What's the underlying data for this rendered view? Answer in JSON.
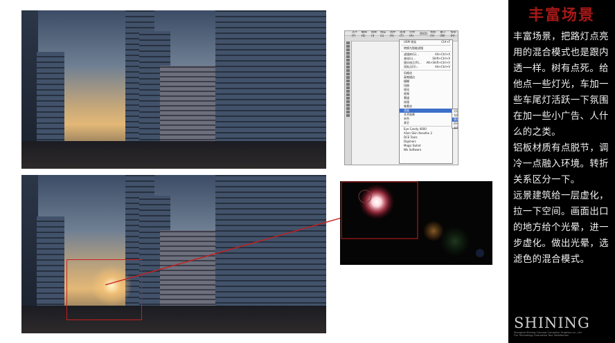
{
  "panel": {
    "title": "丰富场景",
    "paragraphs": [
      "丰富场景，把路灯点亮用的混合模式也是跟内透一样。树有点死。给他点一些灯光，车加一些车尾灯活跃一下氛围在加一些小广告、人什么的之类。",
      "铝板材质有点脱节，调冷一点融入环境。转折关系区分一下。",
      "远景建筑给一层虚化，拉一下空间。画面出口的地方给个光晕，进一步虚化。做出光晕，选滤色的混合模式。"
    ],
    "logo_word": "SHINING",
    "logo_sub1": "Shanghai Shining Concept Computer Graphics co., Ltd",
    "logo_sub2": "Our Technology Guarantee Your Satisfaction"
  },
  "photoshop": {
    "menubar": [
      "文件(F)",
      "编辑(E)",
      "图像(I)",
      "图层(L)",
      "选择(S)",
      "滤镜(T)",
      "分析(A)",
      "3D(D)",
      "视图(V)",
      "窗口(W)",
      "帮助(H)"
    ],
    "menu_items": [
      {
        "label": "USM 锐化",
        "shortcut": "Ctrl+F"
      },
      {
        "label": "转换为智能滤镜",
        "shortcut": ""
      },
      {
        "label": "滤镜库(G)...",
        "shortcut": "Alt+Ctrl+X"
      },
      {
        "label": "液化(L)...",
        "shortcut": "Shift+Ctrl+X"
      },
      {
        "label": "镜头校正(R)...",
        "shortcut": "Alt+Shift+Ctrl+V"
      },
      {
        "label": "消失点(V)...",
        "shortcut": "Alt+Ctrl+V"
      },
      {
        "label": "风格化",
        "shortcut": ""
      },
      {
        "label": "画笔描边",
        "shortcut": ""
      },
      {
        "label": "模糊",
        "shortcut": ""
      },
      {
        "label": "扭曲",
        "shortcut": ""
      },
      {
        "label": "锐化",
        "shortcut": ""
      },
      {
        "label": "视频",
        "shortcut": ""
      },
      {
        "label": "素描",
        "shortcut": ""
      },
      {
        "label": "纹理",
        "shortcut": ""
      },
      {
        "label": "像素化",
        "shortcut": ""
      },
      {
        "label": "渲染",
        "shortcut": ""
      },
      {
        "label": "艺术效果",
        "shortcut": ""
      },
      {
        "label": "杂色",
        "shortcut": ""
      },
      {
        "label": "其它",
        "shortcut": ""
      },
      {
        "label": "Eye Candy 4000",
        "shortcut": ""
      },
      {
        "label": "Alien Skin Xenofex 2",
        "shortcut": ""
      },
      {
        "label": "DCE Tools",
        "shortcut": ""
      },
      {
        "label": "Digimarc",
        "shortcut": ""
      },
      {
        "label": "Magic Bullet",
        "shortcut": ""
      },
      {
        "label": "Nik Software",
        "shortcut": ""
      }
    ],
    "submenu_items": [
      "分层云彩",
      "光照效果...",
      "镜头光晕...",
      "纤维...",
      "云彩"
    ],
    "selected_menu": "渲染",
    "selected_submenu": "镜头光晕..."
  },
  "colors": {
    "panel_bg": "#000000",
    "title_red": "#a81818",
    "annotation_red": "#c81e1e",
    "menu_highlight": "#3d6fc9"
  }
}
